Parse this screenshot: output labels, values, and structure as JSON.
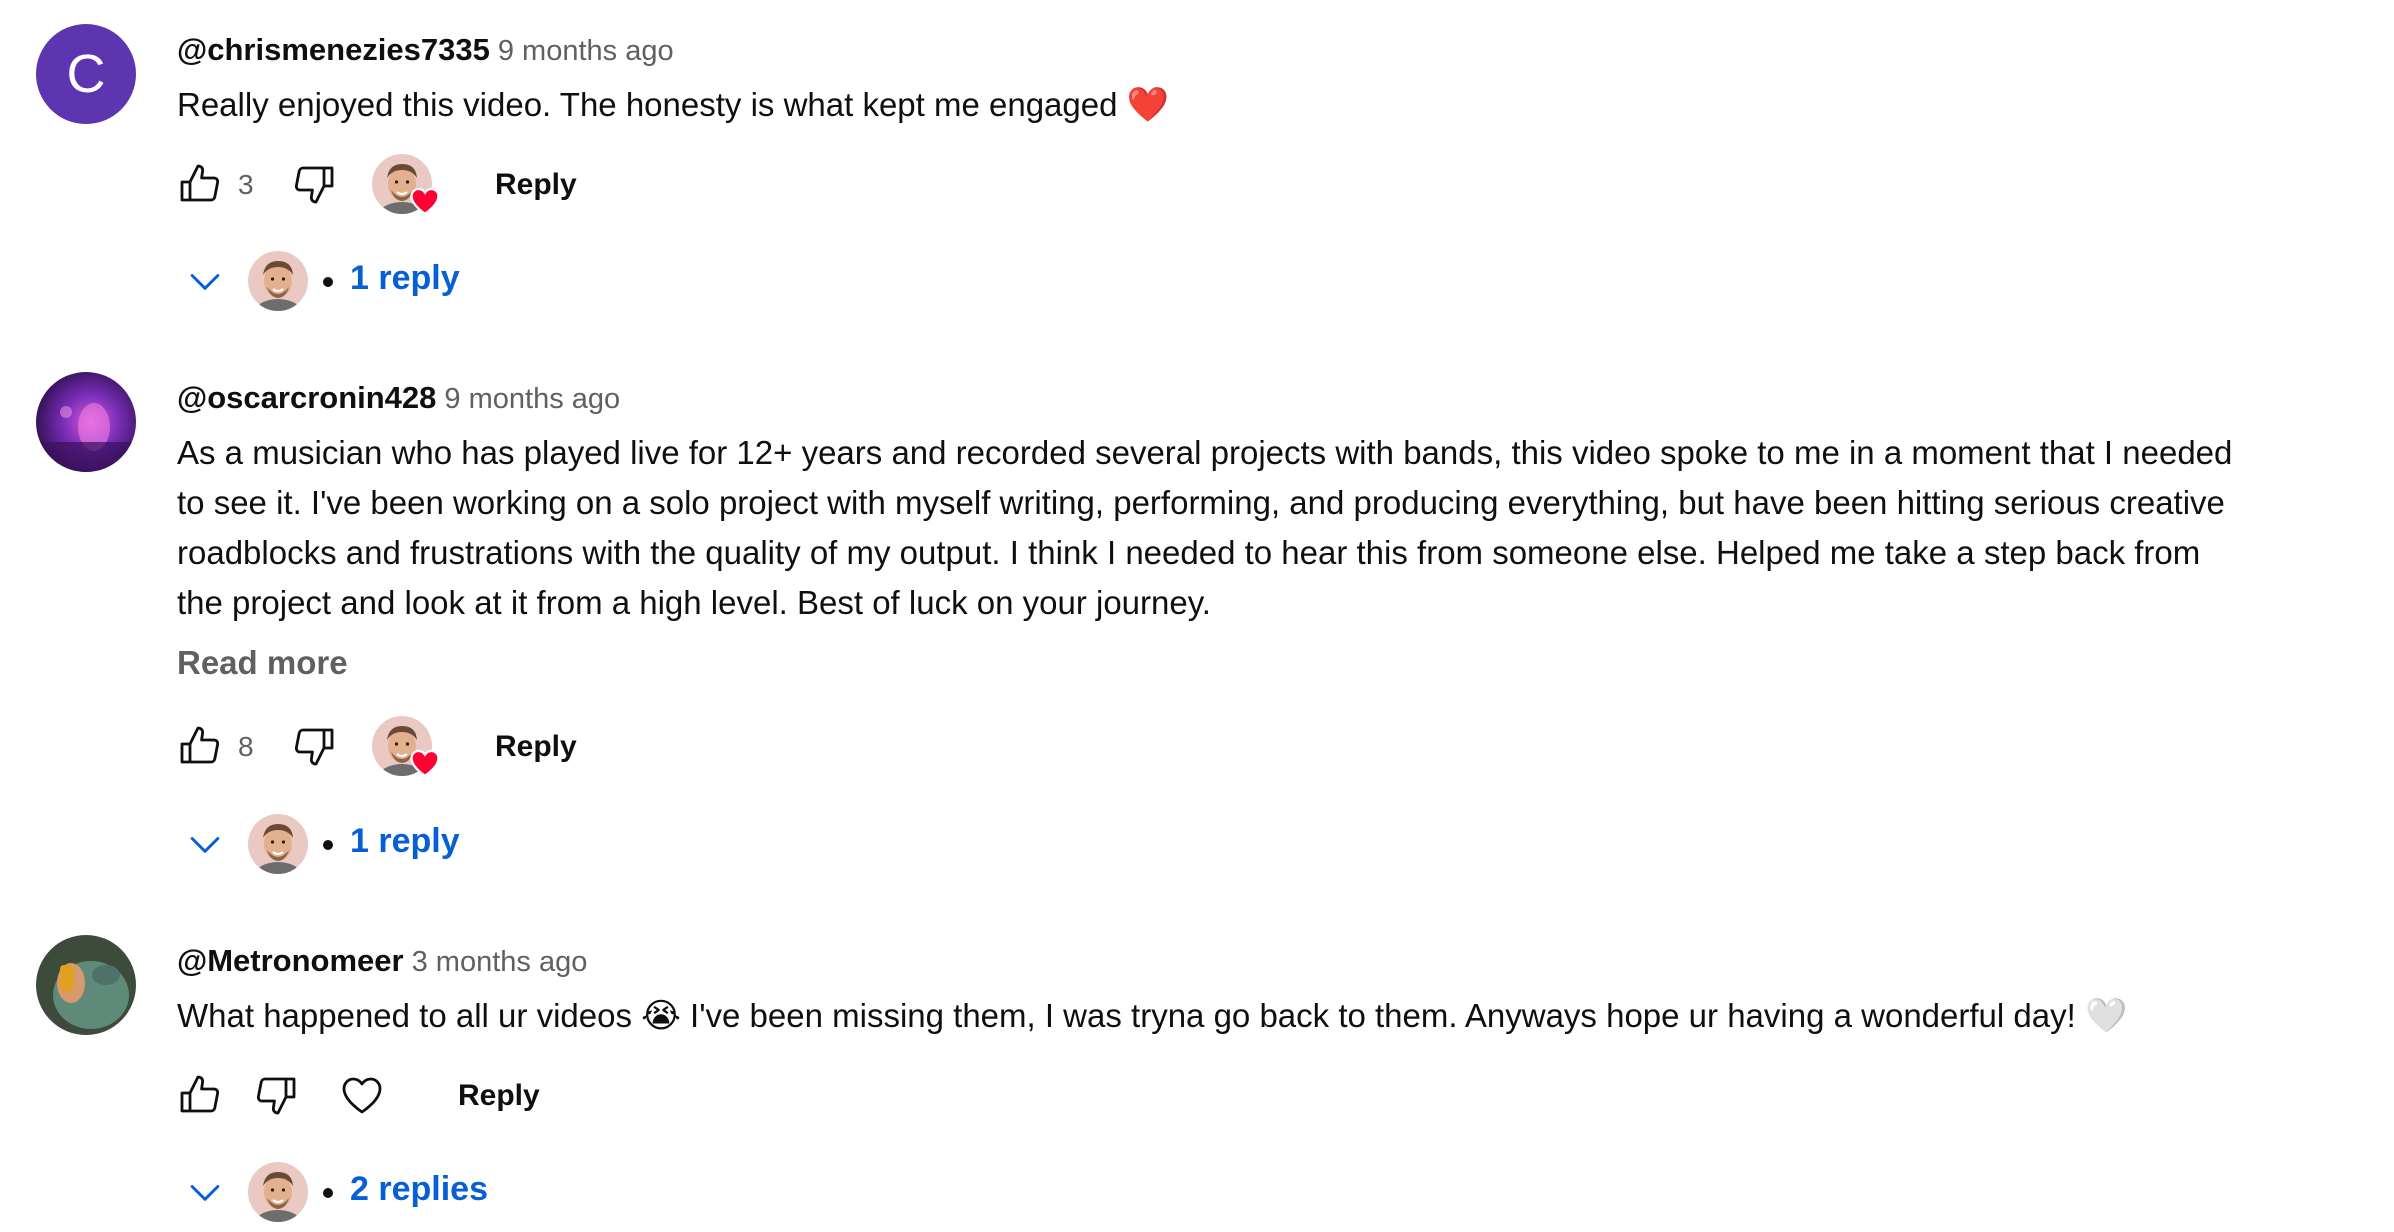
{
  "comments": [
    {
      "author": "@chrismenezies7335",
      "time": "9 months ago",
      "avatar_letter": "C",
      "lines": [
        "Really enjoyed this video. The honesty is what kept me engaged"
      ],
      "trailing_emoji": "❤️",
      "likes": "3",
      "reply_label": "Reply",
      "replies_label": "1 reply"
    },
    {
      "author": "@oscarcronin428",
      "time": "9 months ago",
      "lines": [
        "As a musician who has played live for 12+ years and recorded several projects with bands, this video spoke to me in a moment that I needed",
        "to see it. I've been working on a solo project with myself writing, performing, and producing everything, but have been hitting serious creative",
        "roadblocks and frustrations with the quality of my output. I think I needed to hear this from someone else. Helped me take a step back from",
        "the project and look at it from a high level. Best of luck on your journey."
      ],
      "read_more": "Read more",
      "likes": "8",
      "reply_label": "Reply",
      "replies_label": "1 reply"
    },
    {
      "author": "@Metronomeer",
      "time": "3 months ago",
      "text_before_emoji": "What happened to all ur videos",
      "mid_emoji": "😭",
      "text_after_emoji": "I've been missing them, I was tryna go back to them. Anyways hope ur having a wonderful day!",
      "trailing_emoji": "🤍",
      "reply_label": "Reply",
      "replies_label": "2 replies"
    }
  ],
  "colors": {
    "link": "#065fd4",
    "secondary_text": "#606060",
    "avatar_purple": "#5e35b1",
    "creator_heart": "#ff0033"
  },
  "icons": {
    "like": "thumbs-up-outline",
    "dislike": "thumbs-down-outline",
    "heart_outline": "heart-outline",
    "expand": "chevron-down"
  }
}
